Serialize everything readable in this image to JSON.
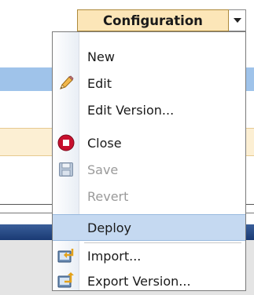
{
  "menu": {
    "title": "Configuration",
    "items": [
      {
        "label": "New",
        "icon": "",
        "enabled": true
      },
      {
        "label": "Edit",
        "icon": "pencil-icon",
        "enabled": true
      },
      {
        "label": "Edit Version...",
        "icon": "",
        "enabled": true
      },
      {
        "label": "Close",
        "icon": "close-circle-icon",
        "enabled": true
      },
      {
        "label": "Save",
        "icon": "floppy-disk-icon",
        "enabled": false
      },
      {
        "label": "Revert",
        "icon": "",
        "enabled": false
      },
      {
        "label": "Deploy",
        "icon": "",
        "enabled": true,
        "highlighted": true
      },
      {
        "label": "Import...",
        "icon": "import-icon",
        "enabled": true
      },
      {
        "label": "Export Version...",
        "icon": "export-icon",
        "enabled": true
      }
    ]
  },
  "colors": {
    "header_fill": "#fce6b8",
    "highlight": "#c5d9f1",
    "disabled_text": "#9a9a9a",
    "close_icon": "#c8102e"
  }
}
